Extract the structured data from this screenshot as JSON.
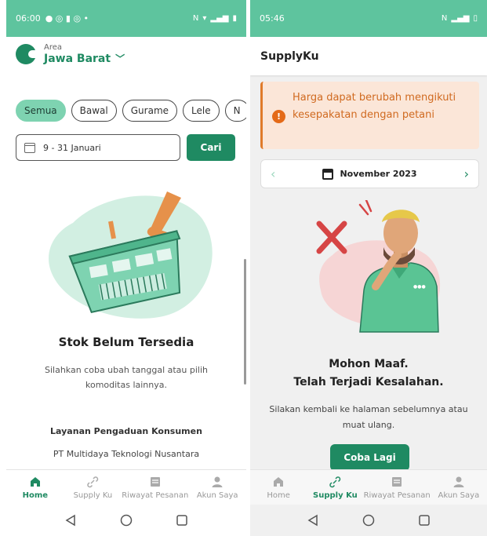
{
  "left": {
    "status": {
      "time": "06:00"
    },
    "area": {
      "caption": "Area",
      "value": "Jawa Barat"
    },
    "chips": [
      "Semua",
      "Bawal",
      "Gurame",
      "Lele",
      "N"
    ],
    "date_range": "9 - 31 Januari",
    "search_button": "Cari",
    "empty": {
      "title": "Stok Belum Tersedia",
      "description": "Silahkan coba ubah tanggal atau pilih komoditas lainnya."
    },
    "complaint": {
      "title": "Layanan Pengaduan Konsumen",
      "company": "PT Multidaya Teknologi Nusantara"
    },
    "nav": [
      {
        "label": "Home",
        "icon": "home-icon",
        "active": true
      },
      {
        "label": "Supply Ku",
        "icon": "link-icon",
        "active": false
      },
      {
        "label": "Riwayat Pesanan",
        "icon": "receipt-icon",
        "active": false
      },
      {
        "label": "Akun Saya",
        "icon": "user-icon",
        "active": false
      }
    ]
  },
  "right": {
    "status": {
      "time": "05:46"
    },
    "app_title": "SupplyKu",
    "alert": {
      "text": "Harga dapat berubah mengikuti kesepakatan dengan petani"
    },
    "month": "November 2023",
    "error": {
      "title_line1": "Mohon Maaf.",
      "title_line2": "Telah Terjadi Kesalahan.",
      "description": "Silakan kembali ke halaman sebelumnya atau muat ulang."
    },
    "retry_button": "Coba Lagi",
    "nav": [
      {
        "label": "Home",
        "icon": "home-icon",
        "active": false
      },
      {
        "label": "Supply Ku",
        "icon": "link-icon",
        "active": true
      },
      {
        "label": "Riwayat Pesanan",
        "icon": "receipt-icon",
        "active": false
      },
      {
        "label": "Akun Saya",
        "icon": "user-icon",
        "active": false
      }
    ]
  },
  "colors": {
    "status_bar": "#5ec49e",
    "primary": "#1f8a62",
    "chip_active": "#7ed3b1",
    "alert_bg": "#fbe6d8",
    "alert_text": "#d06a20"
  }
}
